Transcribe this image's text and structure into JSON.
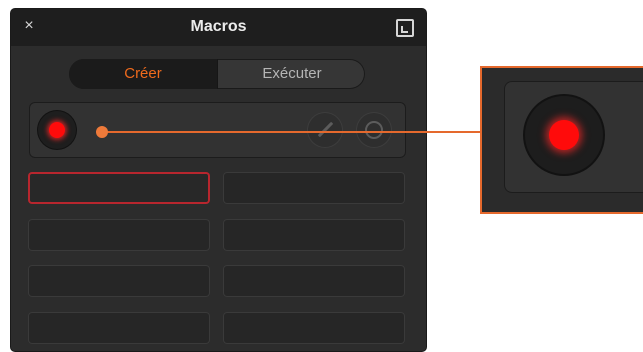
{
  "window": {
    "title": "Macros",
    "close_glyph": "×",
    "close_icon": "close-icon",
    "window_icon": "window-mode-icon"
  },
  "tabs": [
    {
      "label": "Créer",
      "active": true
    },
    {
      "label": "Exécuter",
      "active": false
    }
  ],
  "record_bar": {
    "record_icon": "record-icon",
    "edit_icon": "pencil-icon",
    "stop_icon": "stop-icon",
    "record_color": "#ff0b0b"
  },
  "macro_slots": {
    "count": 8,
    "selected_index": 0,
    "selected_border_color": "#b8262e"
  },
  "callout": {
    "color": "#e5692d",
    "subject": "record-button"
  },
  "colors": {
    "accent": "#ef6a1c",
    "panel_bg": "#2c2c2c",
    "titlebar_bg": "#1e1e1e"
  }
}
